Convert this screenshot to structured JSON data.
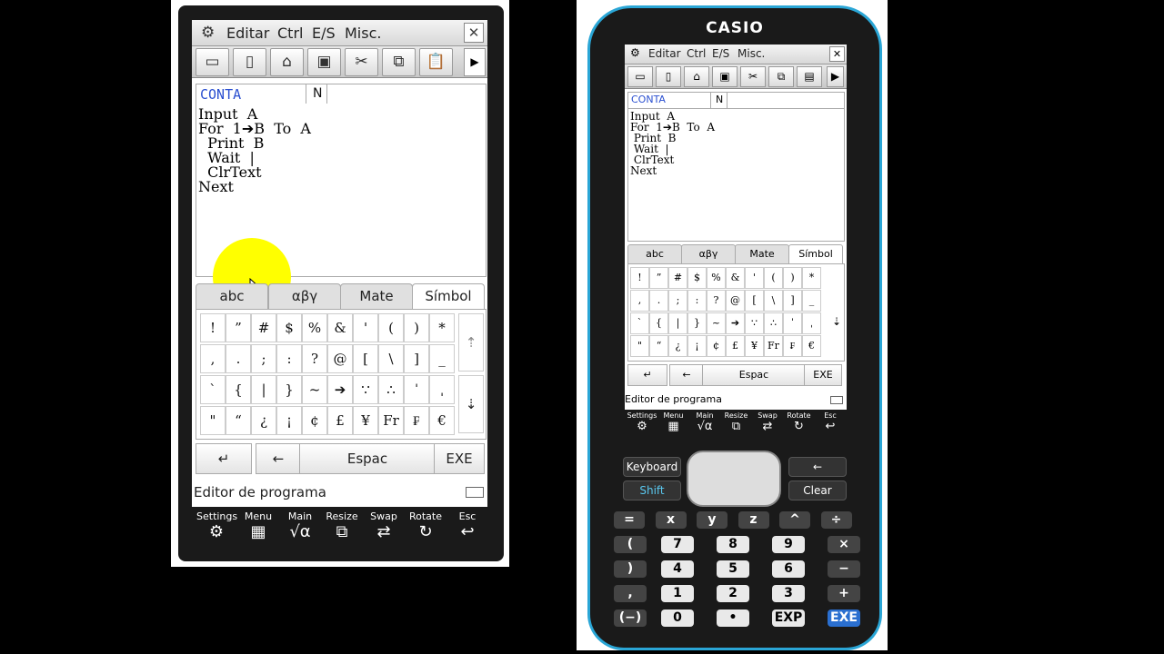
{
  "left": {
    "menu": {
      "items": [
        "Editar",
        "Ctrl",
        "E/S",
        "Misc."
      ],
      "close": "✕"
    },
    "toolbar": {
      "icons": [
        "computer-icon",
        "new-file-icon",
        "open-folder-icon",
        "save-icon",
        "cut-icon",
        "copy-icon",
        "paste-icon"
      ],
      "more": "▶"
    },
    "file": {
      "name": "CONTA",
      "mode": "N"
    },
    "code": [
      "Input  A",
      "For  1➔B  To  A",
      "  Print  B",
      "  Wait  |",
      "  ClrText",
      "Next"
    ],
    "keyboard": {
      "tabs": [
        "abc",
        "αβγ",
        "Mate",
        "Símbol"
      ],
      "active_tab": "Símbol",
      "rows": [
        [
          "!",
          "”",
          "#",
          "$",
          "%",
          "&",
          "'",
          "(",
          ")",
          "*"
        ],
        [
          ",",
          ".",
          ";",
          ":",
          "?",
          "@",
          "[",
          "\\",
          "]",
          "_"
        ],
        [
          "`",
          "{",
          "|",
          "}",
          "~",
          "➔",
          "∵",
          "∴",
          "ˈ",
          "ˌ"
        ],
        [
          "\"",
          "“",
          "¿",
          "¡",
          "¢",
          "£",
          "¥",
          "Fr",
          "₣",
          "€"
        ]
      ],
      "scroll_up": "⇡",
      "scroll_down": "⇣",
      "bottom": {
        "enter": "↵",
        "backspace": "←",
        "space": "Espac",
        "exe": "EXE"
      }
    },
    "status": {
      "label": "Editor de programa"
    },
    "icons": [
      {
        "label": "Settings",
        "glyph": "⚙"
      },
      {
        "label": "Menu",
        "glyph": "▦"
      },
      {
        "label": "Main",
        "glyph": "√α"
      },
      {
        "label": "Resize",
        "glyph": "⧉"
      },
      {
        "label": "Swap",
        "glyph": "⇄"
      },
      {
        "label": "Rotate",
        "glyph": "↻"
      },
      {
        "label": "Esc",
        "glyph": "↩"
      }
    ]
  },
  "right": {
    "brand": "CASIO",
    "menu": {
      "items": [
        "Editar",
        "Ctrl",
        "E/S",
        "Misc."
      ],
      "close": "✕"
    },
    "file": {
      "name": "CONTA",
      "mode": "N"
    },
    "code": [
      "Input  A",
      "For  1➔B  To  A",
      " Print  B",
      " Wait  |",
      " ClrText",
      "Next"
    ],
    "tabs": [
      "abc",
      "αβγ",
      "Mate",
      "Símbol"
    ],
    "rows": [
      [
        "!",
        "”",
        "#",
        "$",
        "%",
        "&",
        "'",
        "(",
        ")",
        "*"
      ],
      [
        ",",
        ".",
        ";",
        ":",
        "?",
        "@",
        "[",
        "\\",
        "]",
        "_"
      ],
      [
        "`",
        "{",
        "|",
        "}",
        "~",
        "➔",
        "∵",
        "∴",
        "ˈ",
        "ˌ"
      ],
      [
        "\"",
        "“",
        "¿",
        "¡",
        "¢",
        "£",
        "¥",
        "Fr",
        "₣",
        "€"
      ]
    ],
    "bottom": {
      "enter": "↵",
      "backspace": "←",
      "space": "Espac",
      "exe": "EXE"
    },
    "status": "Editor de programa",
    "icons": [
      "Settings",
      "Menu",
      "Main",
      "Resize",
      "Swap",
      "Rotate",
      "Esc"
    ],
    "hw": {
      "keyboard": "Keyboard",
      "shift": "Shift",
      "back": "←",
      "clear": "Clear"
    },
    "keypad": [
      [
        "=",
        "x",
        "y",
        "z",
        "^",
        "÷"
      ],
      [
        "(",
        "7",
        "8",
        "9",
        "×"
      ],
      [
        ")",
        "4",
        "5",
        "6",
        "−"
      ],
      [
        ",",
        "1",
        "2",
        "3",
        "+"
      ],
      [
        "(−)",
        "0",
        "•",
        "EXP",
        "EXE"
      ]
    ]
  }
}
